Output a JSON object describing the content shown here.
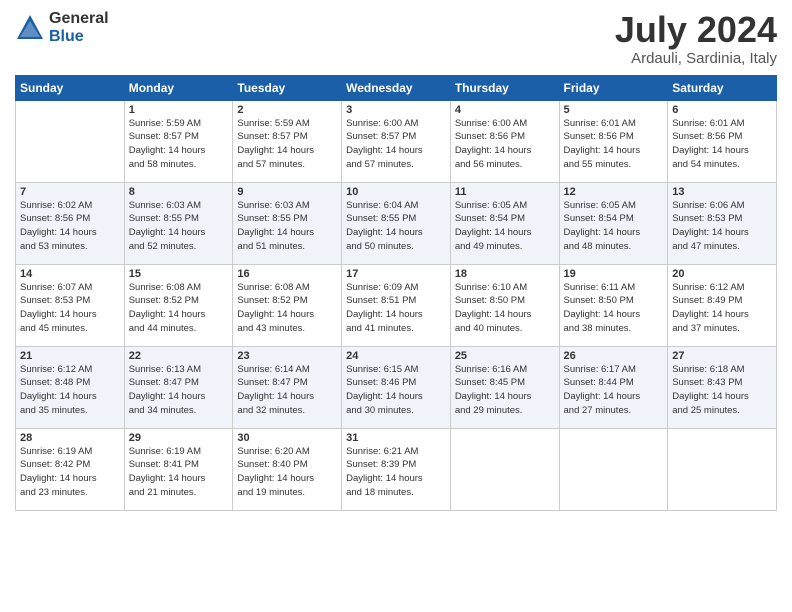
{
  "header": {
    "logo_general": "General",
    "logo_blue": "Blue",
    "month_title": "July 2024",
    "location": "Ardauli, Sardinia, Italy"
  },
  "days_of_week": [
    "Sunday",
    "Monday",
    "Tuesday",
    "Wednesday",
    "Thursday",
    "Friday",
    "Saturday"
  ],
  "weeks": [
    [
      {
        "day": "",
        "info": ""
      },
      {
        "day": "1",
        "info": "Sunrise: 5:59 AM\nSunset: 8:57 PM\nDaylight: 14 hours\nand 58 minutes."
      },
      {
        "day": "2",
        "info": "Sunrise: 5:59 AM\nSunset: 8:57 PM\nDaylight: 14 hours\nand 57 minutes."
      },
      {
        "day": "3",
        "info": "Sunrise: 6:00 AM\nSunset: 8:57 PM\nDaylight: 14 hours\nand 57 minutes."
      },
      {
        "day": "4",
        "info": "Sunrise: 6:00 AM\nSunset: 8:56 PM\nDaylight: 14 hours\nand 56 minutes."
      },
      {
        "day": "5",
        "info": "Sunrise: 6:01 AM\nSunset: 8:56 PM\nDaylight: 14 hours\nand 55 minutes."
      },
      {
        "day": "6",
        "info": "Sunrise: 6:01 AM\nSunset: 8:56 PM\nDaylight: 14 hours\nand 54 minutes."
      }
    ],
    [
      {
        "day": "7",
        "info": "Sunrise: 6:02 AM\nSunset: 8:56 PM\nDaylight: 14 hours\nand 53 minutes."
      },
      {
        "day": "8",
        "info": "Sunrise: 6:03 AM\nSunset: 8:55 PM\nDaylight: 14 hours\nand 52 minutes."
      },
      {
        "day": "9",
        "info": "Sunrise: 6:03 AM\nSunset: 8:55 PM\nDaylight: 14 hours\nand 51 minutes."
      },
      {
        "day": "10",
        "info": "Sunrise: 6:04 AM\nSunset: 8:55 PM\nDaylight: 14 hours\nand 50 minutes."
      },
      {
        "day": "11",
        "info": "Sunrise: 6:05 AM\nSunset: 8:54 PM\nDaylight: 14 hours\nand 49 minutes."
      },
      {
        "day": "12",
        "info": "Sunrise: 6:05 AM\nSunset: 8:54 PM\nDaylight: 14 hours\nand 48 minutes."
      },
      {
        "day": "13",
        "info": "Sunrise: 6:06 AM\nSunset: 8:53 PM\nDaylight: 14 hours\nand 47 minutes."
      }
    ],
    [
      {
        "day": "14",
        "info": "Sunrise: 6:07 AM\nSunset: 8:53 PM\nDaylight: 14 hours\nand 45 minutes."
      },
      {
        "day": "15",
        "info": "Sunrise: 6:08 AM\nSunset: 8:52 PM\nDaylight: 14 hours\nand 44 minutes."
      },
      {
        "day": "16",
        "info": "Sunrise: 6:08 AM\nSunset: 8:52 PM\nDaylight: 14 hours\nand 43 minutes."
      },
      {
        "day": "17",
        "info": "Sunrise: 6:09 AM\nSunset: 8:51 PM\nDaylight: 14 hours\nand 41 minutes."
      },
      {
        "day": "18",
        "info": "Sunrise: 6:10 AM\nSunset: 8:50 PM\nDaylight: 14 hours\nand 40 minutes."
      },
      {
        "day": "19",
        "info": "Sunrise: 6:11 AM\nSunset: 8:50 PM\nDaylight: 14 hours\nand 38 minutes."
      },
      {
        "day": "20",
        "info": "Sunrise: 6:12 AM\nSunset: 8:49 PM\nDaylight: 14 hours\nand 37 minutes."
      }
    ],
    [
      {
        "day": "21",
        "info": "Sunrise: 6:12 AM\nSunset: 8:48 PM\nDaylight: 14 hours\nand 35 minutes."
      },
      {
        "day": "22",
        "info": "Sunrise: 6:13 AM\nSunset: 8:47 PM\nDaylight: 14 hours\nand 34 minutes."
      },
      {
        "day": "23",
        "info": "Sunrise: 6:14 AM\nSunset: 8:47 PM\nDaylight: 14 hours\nand 32 minutes."
      },
      {
        "day": "24",
        "info": "Sunrise: 6:15 AM\nSunset: 8:46 PM\nDaylight: 14 hours\nand 30 minutes."
      },
      {
        "day": "25",
        "info": "Sunrise: 6:16 AM\nSunset: 8:45 PM\nDaylight: 14 hours\nand 29 minutes."
      },
      {
        "day": "26",
        "info": "Sunrise: 6:17 AM\nSunset: 8:44 PM\nDaylight: 14 hours\nand 27 minutes."
      },
      {
        "day": "27",
        "info": "Sunrise: 6:18 AM\nSunset: 8:43 PM\nDaylight: 14 hours\nand 25 minutes."
      }
    ],
    [
      {
        "day": "28",
        "info": "Sunrise: 6:19 AM\nSunset: 8:42 PM\nDaylight: 14 hours\nand 23 minutes."
      },
      {
        "day": "29",
        "info": "Sunrise: 6:19 AM\nSunset: 8:41 PM\nDaylight: 14 hours\nand 21 minutes."
      },
      {
        "day": "30",
        "info": "Sunrise: 6:20 AM\nSunset: 8:40 PM\nDaylight: 14 hours\nand 19 minutes."
      },
      {
        "day": "31",
        "info": "Sunrise: 6:21 AM\nSunset: 8:39 PM\nDaylight: 14 hours\nand 18 minutes."
      },
      {
        "day": "",
        "info": ""
      },
      {
        "day": "",
        "info": ""
      },
      {
        "day": "",
        "info": ""
      }
    ]
  ]
}
